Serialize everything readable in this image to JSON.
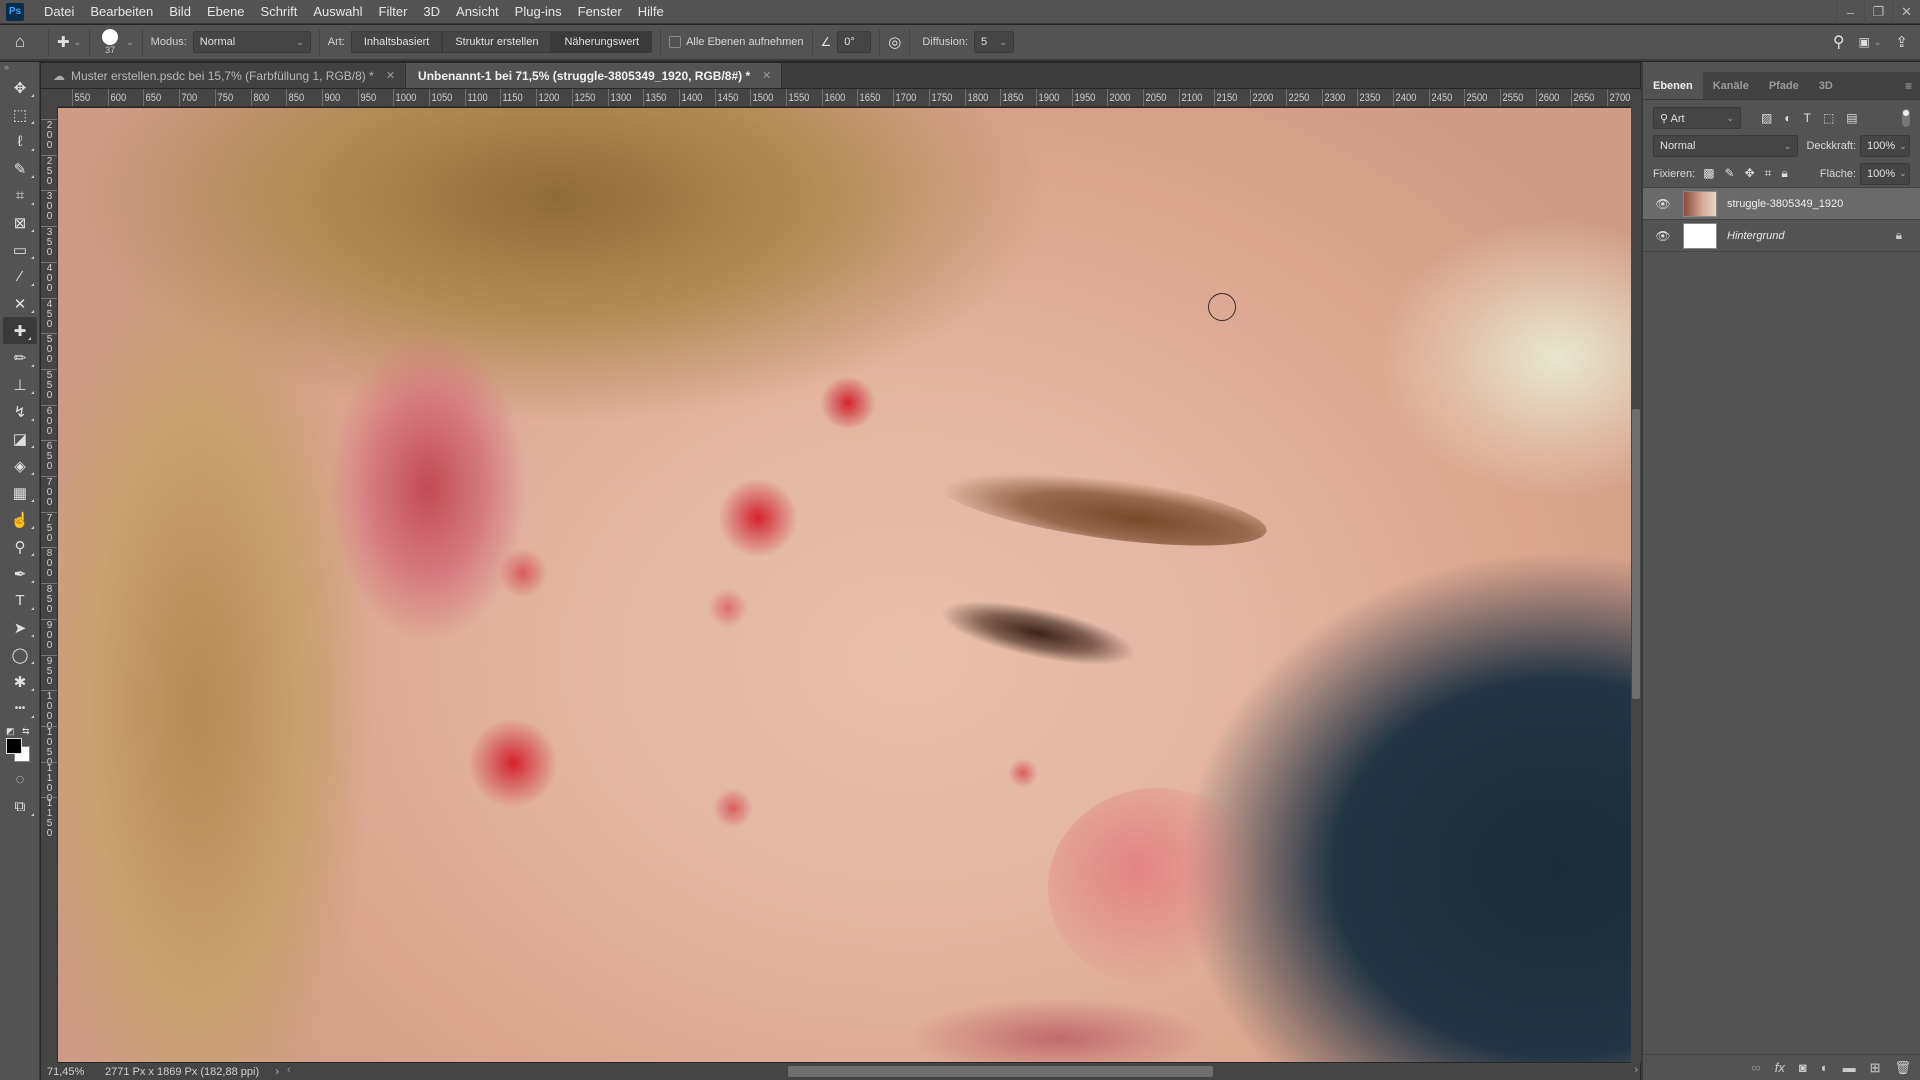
{
  "app": {
    "logo": "Ps"
  },
  "menu": [
    "Datei",
    "Bearbeiten",
    "Bild",
    "Ebene",
    "Schrift",
    "Auswahl",
    "Filter",
    "3D",
    "Ansicht",
    "Plug-ins",
    "Fenster",
    "Hilfe"
  ],
  "window_controls": {
    "minimize": "–",
    "restore": "❐",
    "close": "✕"
  },
  "options": {
    "brush_size": "37",
    "modus_label": "Modus:",
    "modus_value": "Normal",
    "art_label": "Art:",
    "art_options": [
      "Inhaltsbasiert",
      "Struktur erstellen",
      "Näherungswert"
    ],
    "art_selected": "Näherungswert",
    "sample_all_label": "Alle Ebenen aufnehmen",
    "sample_all_checked": false,
    "angle_value": "0°",
    "diffusion_label": "Diffusion:",
    "diffusion_value": "5"
  },
  "tools": [
    {
      "name": "move",
      "glyph": "✥"
    },
    {
      "name": "rect-marquee",
      "glyph": "⬚"
    },
    {
      "name": "lasso",
      "glyph": "ℓ"
    },
    {
      "name": "quick-selection",
      "glyph": "✎"
    },
    {
      "name": "crop",
      "glyph": "⌗"
    },
    {
      "name": "frame",
      "glyph": "⊠"
    },
    {
      "name": "ruler",
      "glyph": "▭"
    },
    {
      "name": "eyedropper",
      "glyph": "⁄"
    },
    {
      "name": "content-aware-move",
      "glyph": "✕"
    },
    {
      "name": "spot-healing-brush",
      "glyph": "✚",
      "active": true
    },
    {
      "name": "brush",
      "glyph": "✏"
    },
    {
      "name": "clone-stamp",
      "glyph": "⊥"
    },
    {
      "name": "history-brush",
      "glyph": "↯"
    },
    {
      "name": "eraser",
      "glyph": "◪"
    },
    {
      "name": "paint-bucket",
      "glyph": "◈"
    },
    {
      "name": "gradient",
      "glyph": "▦"
    },
    {
      "name": "smudge",
      "glyph": "☝"
    },
    {
      "name": "dodge",
      "glyph": "⚲"
    },
    {
      "name": "pen",
      "glyph": "✒"
    },
    {
      "name": "type",
      "glyph": "T"
    },
    {
      "name": "path-selection",
      "glyph": "➤"
    },
    {
      "name": "ellipse",
      "glyph": "◯"
    },
    {
      "name": "custom-shape",
      "glyph": "✱"
    },
    {
      "name": "more-tools",
      "glyph": "•••"
    }
  ],
  "colors": {
    "foreground": "#000000",
    "background": "#ffffff",
    "accent": "#31a8ff"
  },
  "tabs": [
    {
      "label": "Muster erstellen.psdc bei 15,7% (Farbfüllung 1, RGB/8) *",
      "active": false,
      "cloud": true
    },
    {
      "label": "Unbenannt-1 bei 71,5% (struggle-3805349_1920, RGB/8#) *",
      "active": true
    }
  ],
  "ruler_h": [
    "550",
    "600",
    "650",
    "700",
    "750",
    "800",
    "850",
    "900",
    "950",
    "1000",
    "1050",
    "1100",
    "1150",
    "1200",
    "1250",
    "1300",
    "1350",
    "1400",
    "1450",
    "1500",
    "1550",
    "1600",
    "1650",
    "1700",
    "1750",
    "1800",
    "1850",
    "1900",
    "1950",
    "2000",
    "2050",
    "2100",
    "2150",
    "2200",
    "2250",
    "2300",
    "2350",
    "2400",
    "2450",
    "2500",
    "2550",
    "2600",
    "2650",
    "2700"
  ],
  "ruler_v": [
    "200",
    "250",
    "300",
    "350",
    "400",
    "450",
    "500",
    "550",
    "600",
    "650",
    "700",
    "750",
    "800",
    "850",
    "900",
    "950",
    "1000",
    "1050",
    "1100",
    "1150"
  ],
  "status": {
    "zoom": "71,45%",
    "doc_info": "2771 Px x 1869 Px (182,88 ppi)"
  },
  "layers_panel": {
    "tabs": [
      "Ebenen",
      "Kanäle",
      "Pfade",
      "3D"
    ],
    "active_tab": "Ebenen",
    "filter_label": "Art",
    "blend_mode": "Normal",
    "opacity_label": "Deckkraft:",
    "opacity_value": "100%",
    "lock_label": "Fixieren:",
    "fill_label": "Fläche:",
    "fill_value": "100%",
    "layers": [
      {
        "name": "struggle-3805349_1920",
        "visible": true,
        "selected": true
      },
      {
        "name": "Hintergrund",
        "visible": true,
        "locked": true,
        "italic": true
      }
    ]
  }
}
